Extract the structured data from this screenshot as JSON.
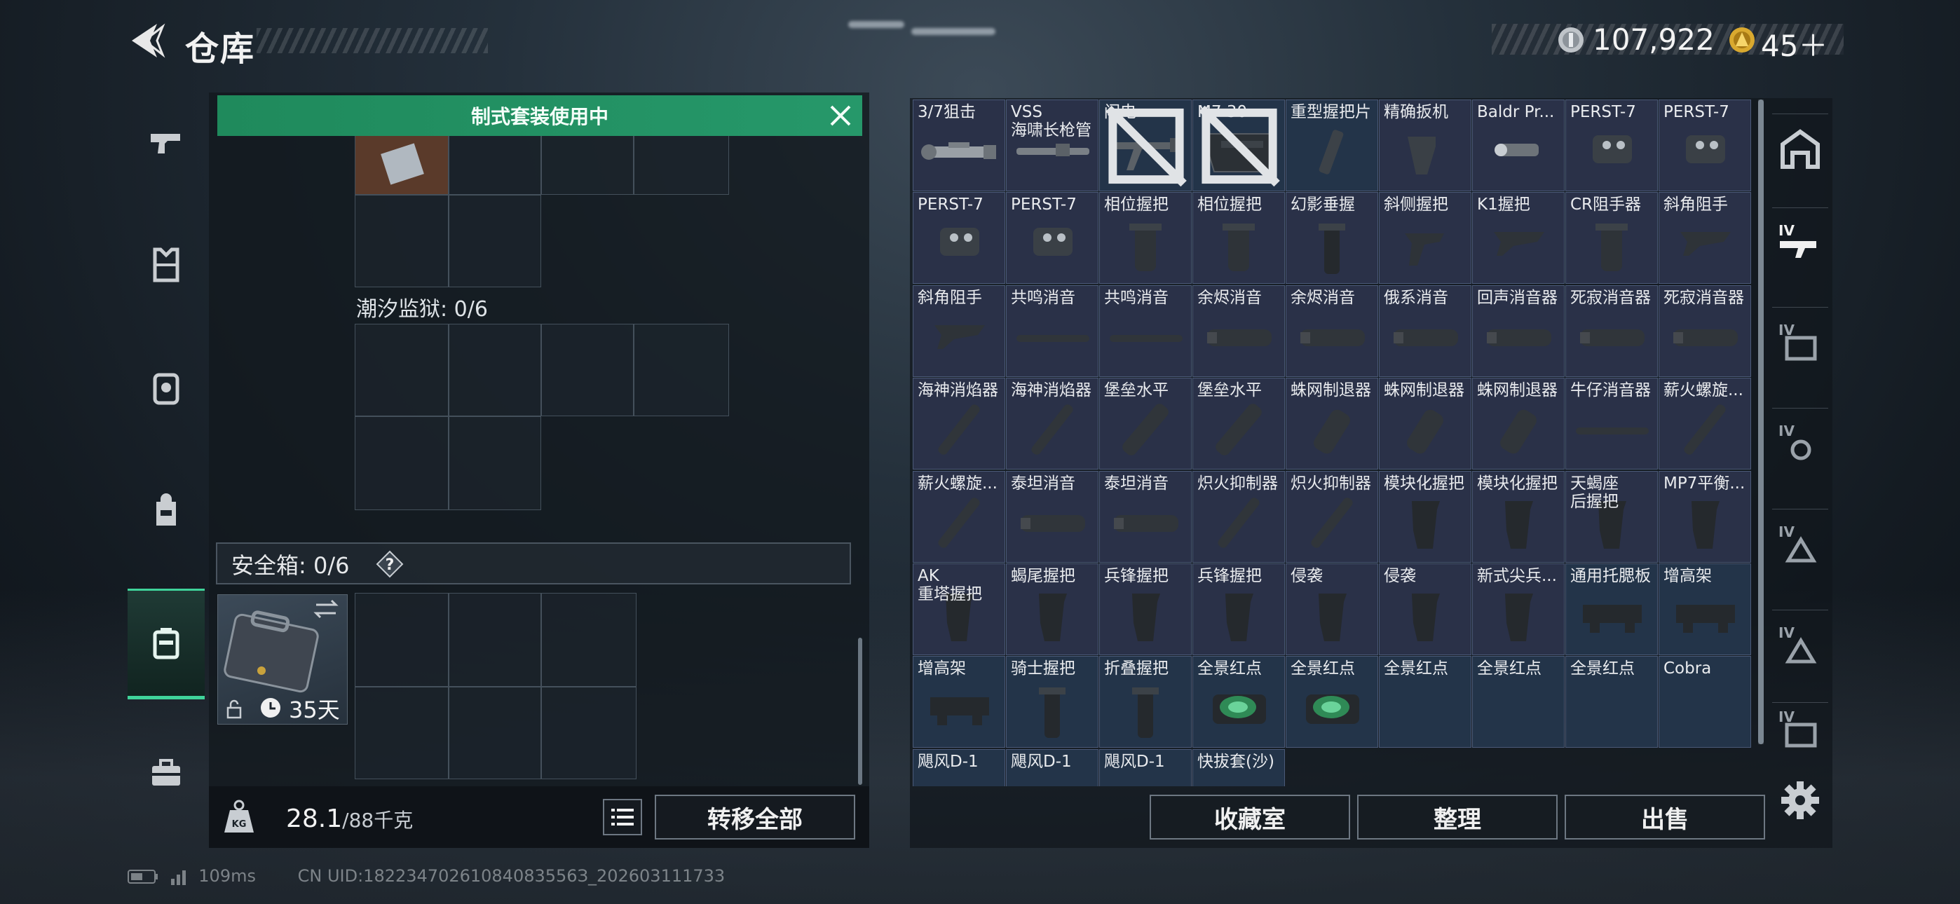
{
  "header": {
    "title": "仓库",
    "currency_silver": "107,922",
    "currency_gold": "45＋"
  },
  "sidebar": {
    "items": [
      {
        "name": "sidebar-item-weapons",
        "icon": "pistol-icon"
      },
      {
        "name": "sidebar-item-vest",
        "icon": "vest-icon"
      },
      {
        "name": "sidebar-item-armor",
        "icon": "armor-icon"
      },
      {
        "name": "sidebar-item-backpack",
        "icon": "backpack-icon"
      },
      {
        "name": "sidebar-item-case",
        "icon": "case-icon",
        "active": true
      },
      {
        "name": "sidebar-item-toolbox",
        "icon": "toolbox-icon"
      }
    ]
  },
  "loadout": {
    "notice": "制式套装使用中",
    "tidal_prison_label": "潮汐监狱: 0/6",
    "safe_box_label": "安全箱: 0/6",
    "help": "?",
    "case_days": "35天",
    "weight_value": "28.1",
    "weight_max": "/88千克",
    "transfer_all": "转移全部"
  },
  "stash": {
    "items": [
      {
        "name": "3/7狙击",
        "shape": "scope",
        "blue": false
      },
      {
        "name": "VSS\n海啸长枪管",
        "shape": "barrel",
        "blue": false
      },
      {
        "name": "闪电",
        "shape": "stock",
        "blue": true,
        "nolock": true
      },
      {
        "name": "M7 30",
        "shape": "mag",
        "blue": true,
        "nolock": true
      },
      {
        "name": "重型握把片",
        "shape": "plate",
        "blue": true
      },
      {
        "name": "精确扳机",
        "shape": "trigger",
        "blue": false
      },
      {
        "name": "Baldr Pr...",
        "shape": "light",
        "blue": false
      },
      {
        "name": "PERST-7",
        "shape": "laser",
        "blue": false
      },
      {
        "name": "PERST-7",
        "shape": "laser",
        "blue": false
      },
      {
        "name": "PERST-7",
        "shape": "laser",
        "blue": false
      },
      {
        "name": "PERST-7",
        "shape": "laser",
        "blue": false
      },
      {
        "name": "相位握把",
        "shape": "vgrip",
        "blue": false
      },
      {
        "name": "相位握把",
        "shape": "vgrip",
        "blue": false
      },
      {
        "name": "幻影垂握",
        "shape": "vgrip2",
        "blue": false
      },
      {
        "name": "斜侧握把",
        "shape": "angled",
        "blue": false
      },
      {
        "name": "K1握把",
        "shape": "angled2",
        "blue": false
      },
      {
        "name": "CR阻手器",
        "shape": "vgrip",
        "blue": false
      },
      {
        "name": "斜角阻手",
        "shape": "angled2",
        "blue": false
      },
      {
        "name": "斜角阻手",
        "shape": "angled2",
        "blue": false
      },
      {
        "name": "共鸣消音",
        "shape": "thin",
        "blue": false
      },
      {
        "name": "共鸣消音",
        "shape": "thin",
        "blue": false
      },
      {
        "name": "余烬消音",
        "shape": "can",
        "blue": false
      },
      {
        "name": "余烬消音",
        "shape": "can",
        "blue": false
      },
      {
        "name": "俄系消音",
        "shape": "can",
        "blue": false
      },
      {
        "name": "回声消音器",
        "shape": "can",
        "blue": false
      },
      {
        "name": "死寂消音器",
        "shape": "can",
        "blue": false
      },
      {
        "name": "死寂消音器",
        "shape": "can",
        "blue": false
      },
      {
        "name": "海神消焰器",
        "shape": "diag",
        "blue": false
      },
      {
        "name": "海神消焰器",
        "shape": "diag",
        "blue": false
      },
      {
        "name": "堡垒水平",
        "shape": "diagfat",
        "blue": false
      },
      {
        "name": "堡垒水平",
        "shape": "diagfat",
        "blue": false
      },
      {
        "name": "蛛网制退器",
        "shape": "brake",
        "blue": false
      },
      {
        "name": "蛛网制退器",
        "shape": "brake",
        "blue": false
      },
      {
        "name": "蛛网制退器",
        "shape": "brake",
        "blue": false
      },
      {
        "name": "牛仔消音器",
        "shape": "thin",
        "blue": false
      },
      {
        "name": "薪火螺旋...",
        "shape": "diag",
        "blue": false
      },
      {
        "name": "薪火螺旋...",
        "shape": "diag",
        "blue": false
      },
      {
        "name": "泰坦消音",
        "shape": "can",
        "blue": false
      },
      {
        "name": "泰坦消音",
        "shape": "can",
        "blue": false
      },
      {
        "name": "炽火抑制器",
        "shape": "diag",
        "blue": false
      },
      {
        "name": "炽火抑制器",
        "shape": "diag",
        "blue": false
      },
      {
        "name": "模块化握把",
        "shape": "pgrip",
        "blue": false
      },
      {
        "name": "模块化握把",
        "shape": "pgrip",
        "blue": false
      },
      {
        "name": "天蝎座\n后握把",
        "shape": "pgrip",
        "blue": false
      },
      {
        "name": "MP7平衡...",
        "shape": "pgrip",
        "blue": false
      },
      {
        "name": "AK\n重塔握把",
        "shape": "pgrip",
        "blue": false
      },
      {
        "name": "蝎尾握把",
        "shape": "pgrip",
        "blue": false
      },
      {
        "name": "兵锋握把",
        "shape": "pgrip",
        "blue": false
      },
      {
        "name": "兵锋握把",
        "shape": "pgrip",
        "blue": false
      },
      {
        "name": "侵袭",
        "shape": "pgrip",
        "blue": false
      },
      {
        "name": "侵袭",
        "shape": "pgrip",
        "blue": false
      },
      {
        "name": "新式尖兵...",
        "shape": "pgrip",
        "blue": false
      },
      {
        "name": "通用托腮板",
        "shape": "riser",
        "blue": true
      },
      {
        "name": "增高架",
        "shape": "riser",
        "blue": true
      },
      {
        "name": "增高架",
        "shape": "riser",
        "blue": true
      },
      {
        "name": "骑士握把",
        "shape": "vgrip2",
        "blue": true
      },
      {
        "name": "折叠握把",
        "shape": "vgrip2",
        "blue": true
      },
      {
        "name": "全景红点",
        "shape": "reddot",
        "blue": true
      },
      {
        "name": "全景红点",
        "shape": "reddot",
        "blue": true
      },
      {
        "name": "全景红点",
        "shape": "none",
        "blue": true
      },
      {
        "name": "全景红点",
        "shape": "none",
        "blue": true
      },
      {
        "name": "全景红点",
        "shape": "none",
        "blue": true
      },
      {
        "name": "Cobra",
        "shape": "none",
        "blue": true
      },
      {
        "name": "飓风D-1",
        "shape": "none",
        "blue": true
      },
      {
        "name": "飓风D-1",
        "shape": "none",
        "blue": true
      },
      {
        "name": "飓风D-1",
        "shape": "none",
        "blue": true
      },
      {
        "name": "快拔套(沙)",
        "shape": "none",
        "blue": true
      }
    ],
    "buttons": {
      "collection": "收藏室",
      "organize": "整理",
      "sell": "出售"
    }
  },
  "status": {
    "ping": "109ms",
    "uid": "CN UID:18223470261084083556З_202603111733"
  },
  "colors": {
    "accent": "#26986a",
    "item_bg": "#2a3148",
    "item_blue_bg": "#233449"
  }
}
